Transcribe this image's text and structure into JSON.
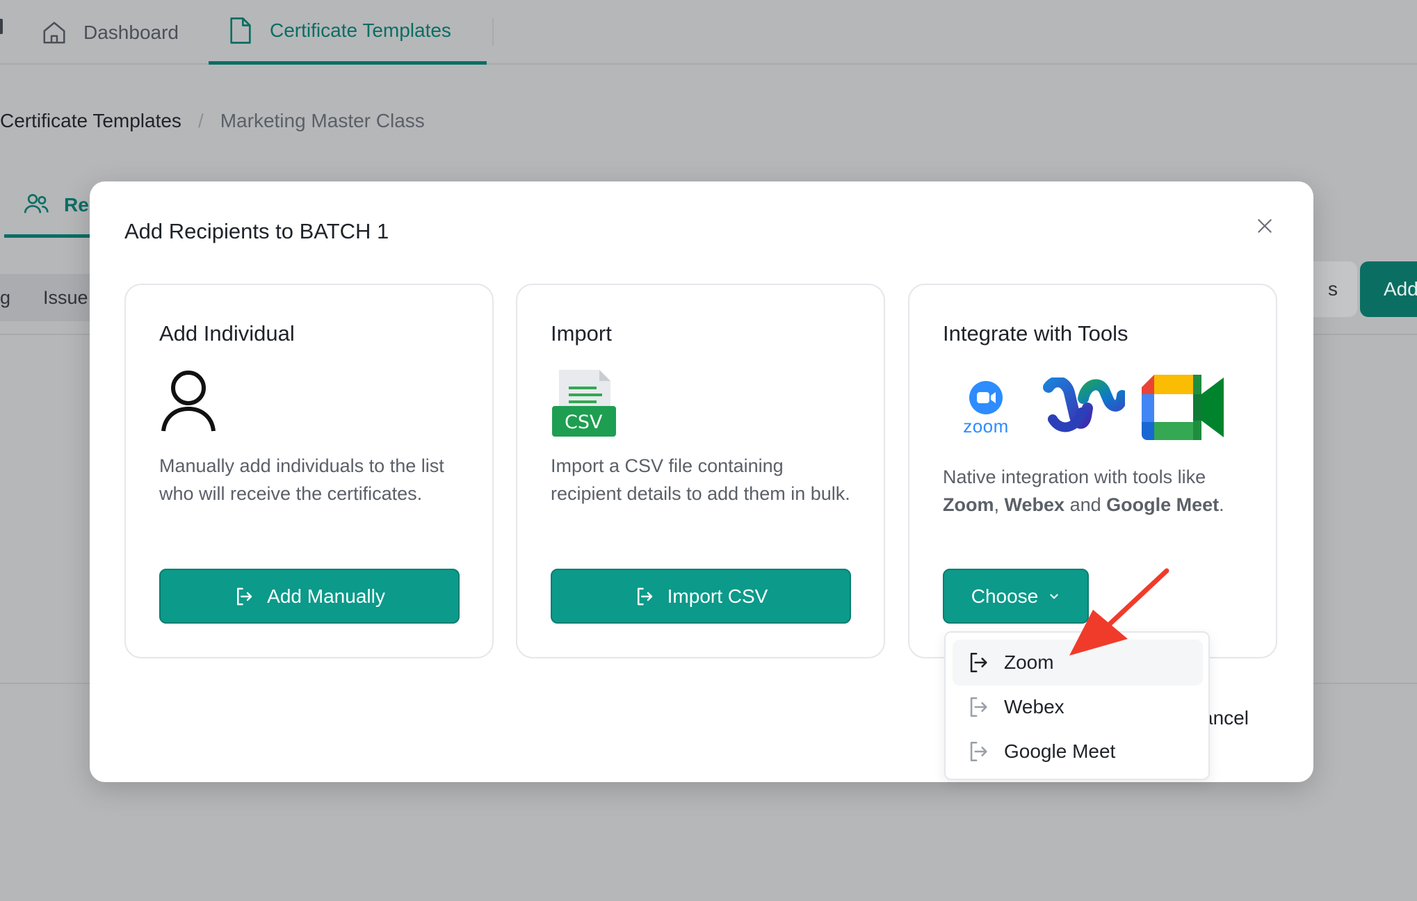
{
  "topnav": {
    "dashboard_label": "Dashboard",
    "certificates_label": "Certificate Templates"
  },
  "breadcrumb": {
    "parent": "Certificate Templates",
    "separator": "/",
    "current": "Marketing Master Class"
  },
  "subtabs": {
    "recipients_label": "Re"
  },
  "filterbar": {
    "left_fragment": "g",
    "issued_label": "Issue",
    "right_fragment": "s",
    "add_fragment": "Add"
  },
  "modal": {
    "title": "Add Recipients to BATCH 1",
    "cards": [
      {
        "title": "Add Individual",
        "description": "Manually add individuals to the list who will receive the certificates.",
        "button_label": "Add Manually"
      },
      {
        "title": "Import",
        "description": "Import a CSV file containing recipient details to add them in bulk.",
        "button_label": "Import CSV",
        "csv_badge": "CSV"
      },
      {
        "title": "Integrate with Tools",
        "description_prefix": "Native integration with tools like ",
        "tool_1": "Zoom",
        "sep_1": ", ",
        "tool_2": "Webex",
        "sep_2": " and ",
        "tool_3": "Google Meet",
        "description_suffix": ".",
        "button_label": "Choose",
        "zoom_wordmark": "zoom"
      }
    ],
    "cancel_fragment": "ancel"
  },
  "dropdown": {
    "items": [
      {
        "label": "Zoom",
        "icon": "sign-in-icon"
      },
      {
        "label": "Webex",
        "icon": "sign-in-icon"
      },
      {
        "label": "Google Meet",
        "icon": "sign-in-icon"
      }
    ]
  },
  "colors": {
    "primary": "#0c9a8a",
    "primary_dark": "#0a6e63",
    "overlay_bg": "#b6b7b9",
    "annotation_arrow": "#f03b2b"
  }
}
